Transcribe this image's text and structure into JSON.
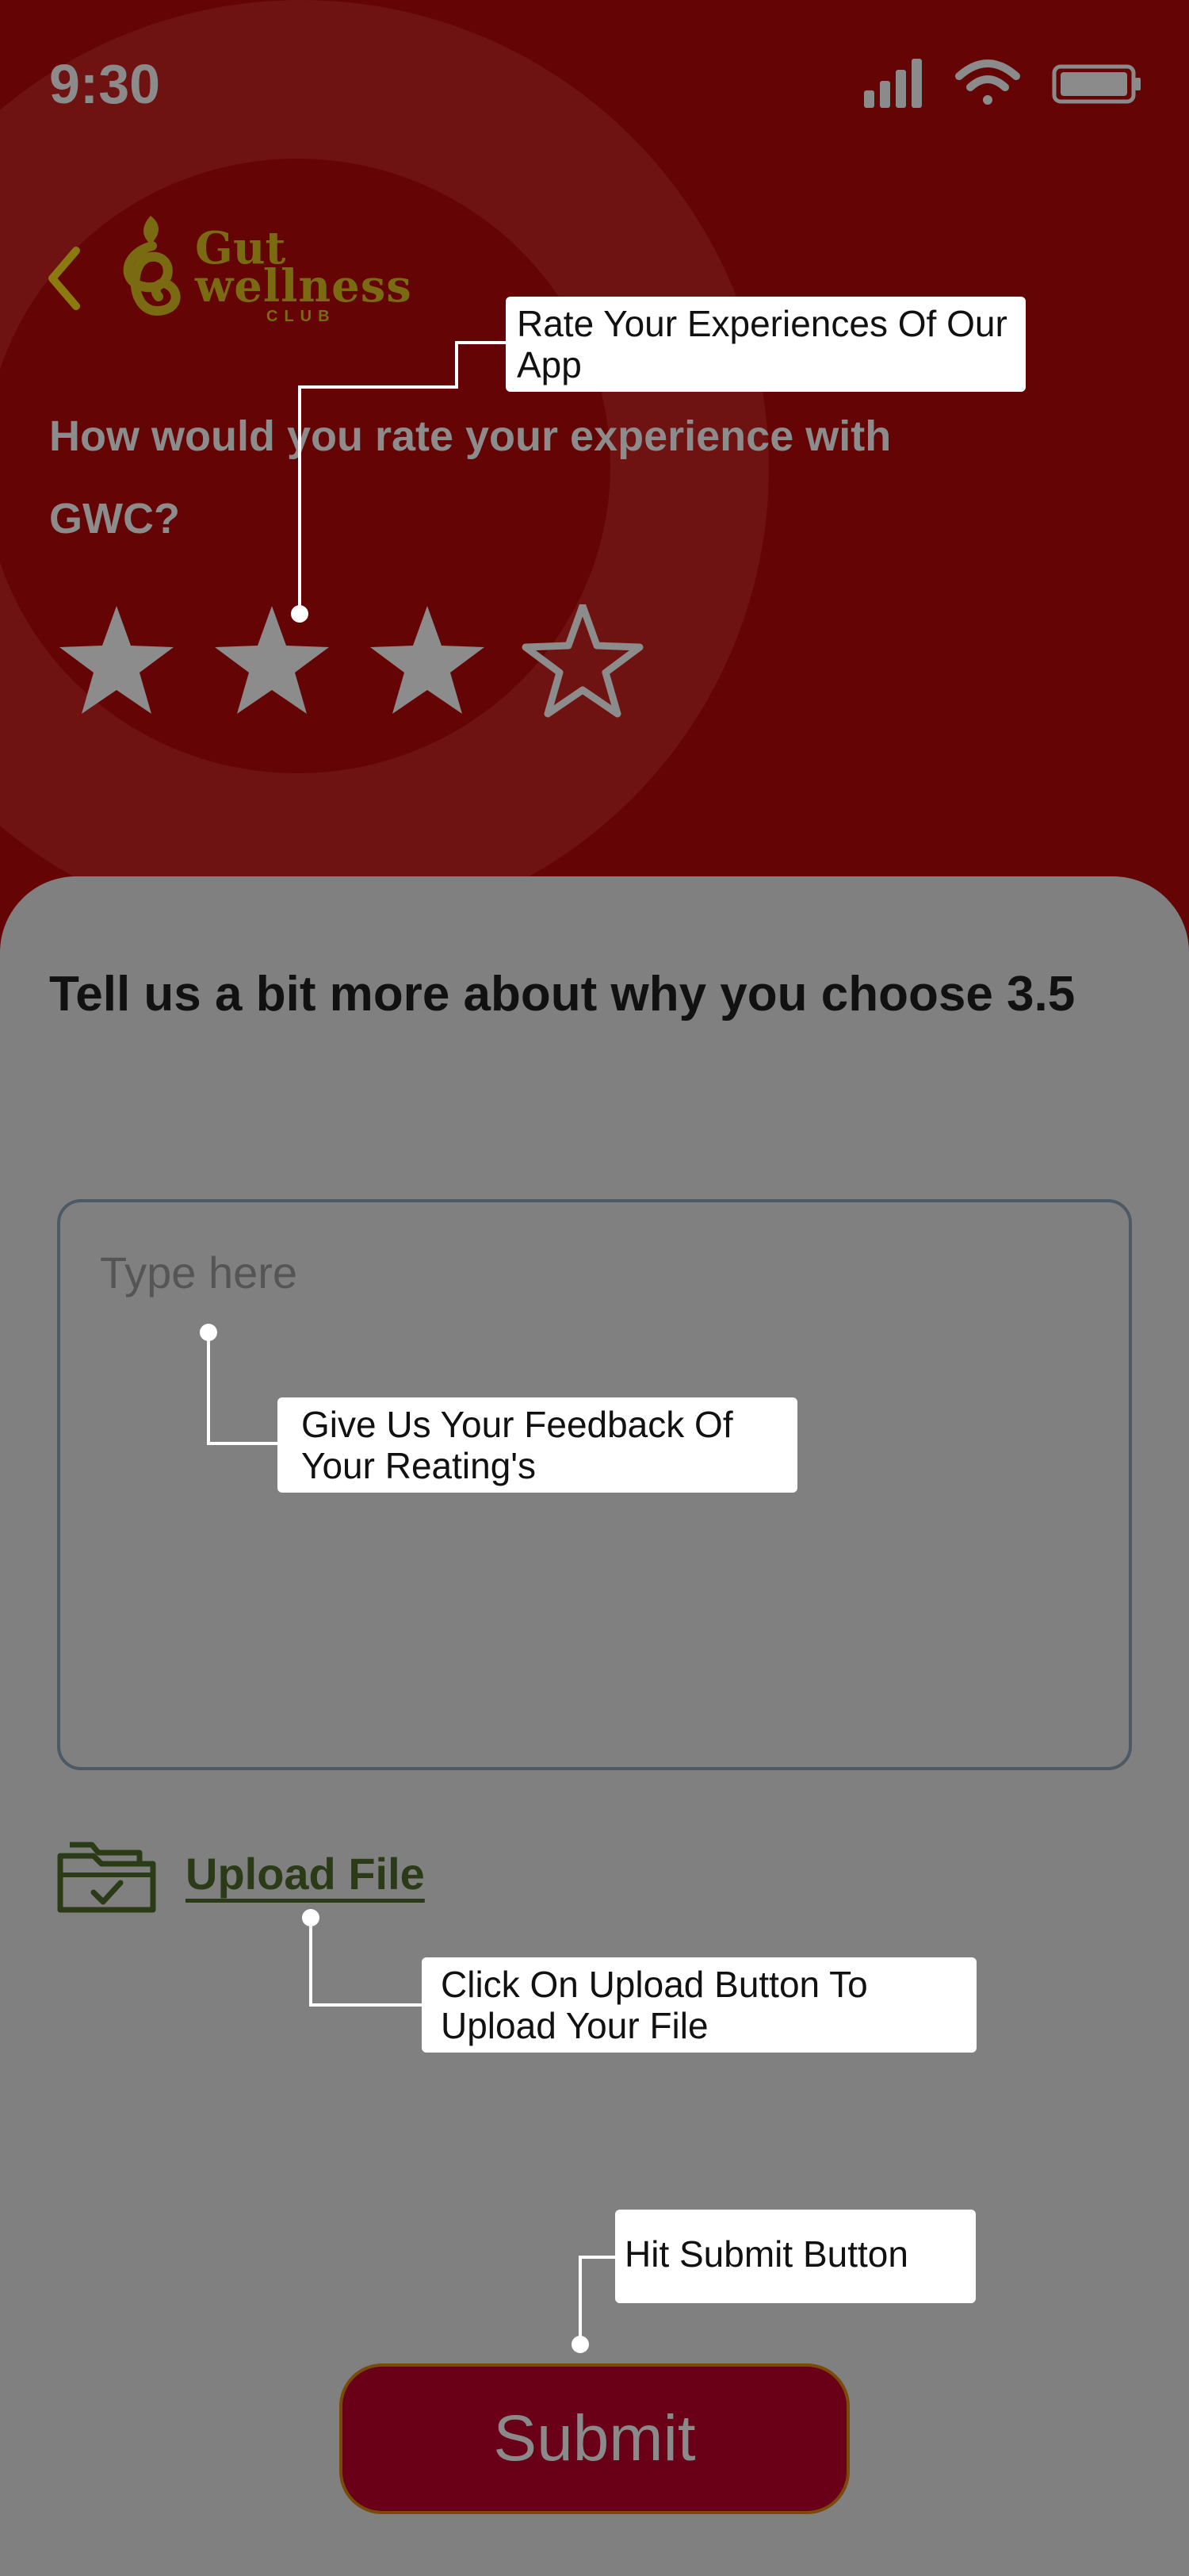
{
  "status_bar": {
    "time": "9:30"
  },
  "header": {
    "logo": {
      "line1": "Gut",
      "line2": "wellness",
      "line3": "CLUB"
    }
  },
  "rating": {
    "question": "How would you rate your experience with GWC?",
    "value": 3.5,
    "max": 5,
    "stars_shown": 4
  },
  "feedback": {
    "heading": "Tell us a bit more about why you choose 3.5",
    "placeholder": "Type here",
    "value": ""
  },
  "upload": {
    "label": "Upload File"
  },
  "submit": {
    "label": "Submit"
  },
  "callouts": {
    "rate": "Rate Your Experiences Of Our App",
    "feedback": "Give Us Your Feedback Of Your Reating's",
    "upload": "Click On Upload Button To Upload Your File",
    "submit": "Hit Submit Button"
  },
  "colors": {
    "background": "#650404",
    "sheet": "#808080",
    "accent": "#690017",
    "link": "#2c3b17",
    "star": "#8c8c8c",
    "logo": "#7a6a12"
  },
  "icons": [
    "signal-icon",
    "wifi-icon",
    "battery-icon",
    "back-chevron-icon",
    "star-icon",
    "half-star-icon",
    "folder-check-icon"
  ]
}
